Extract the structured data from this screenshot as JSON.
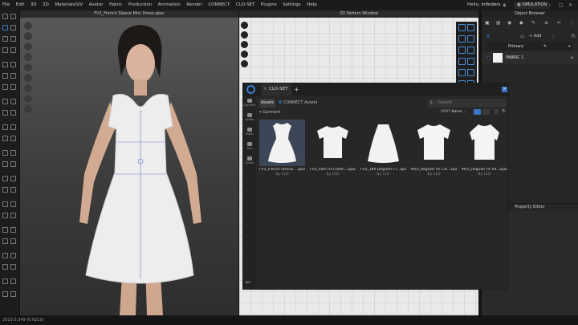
{
  "menubar": {
    "items": [
      "File",
      "Edit",
      "3D",
      "2D",
      "Materials/UV",
      "Avatar",
      "Fabric",
      "Production",
      "Animation",
      "Render",
      "CONNECT",
      "CLO-SET",
      "Plugins",
      "Settings",
      "Help"
    ],
    "greeting": "Hello,",
    "user": "infinders",
    "simulation": "SIMULATION"
  },
  "viewport3d": {
    "title": "FV2_French Sleeve Mini Dress.zpac"
  },
  "pattern_window": {
    "title": "2D Pattern Window"
  },
  "object_browser": {
    "title": "Object Browser",
    "add_label": "Add",
    "primary_label": "Primary",
    "fabric_name": "FABRIC 1"
  },
  "property_editor": {
    "title": "Property Editor"
  },
  "statusbar": {
    "text": "2023.0.349 (0.6210)"
  },
  "clo_panel": {
    "tab_title": "CLO-SET",
    "close": "×",
    "plus": "+",
    "sidebar": [
      "Garment",
      "Avatar",
      "Fabric",
      "Trim",
      "Scene"
    ],
    "tabs": {
      "assets": "Assets",
      "connect": "CONNECT Assets"
    },
    "search_placeholder": "Search",
    "breadcrumb": "Garment",
    "sort": {
      "label": "SORT",
      "value": "Name"
    },
    "items": [
      {
        "name": "FV2_French Sleeve ...zpac",
        "by": "By CLO"
      },
      {
        "name": "FV2_Slim Fit Crewn...zpac",
        "by": "By CLO"
      },
      {
        "name": "FV2_180 Degrees Fl...zpac",
        "by": "By CLO"
      },
      {
        "name": "MV2_Regular Fit Cre...zpac",
        "by": "By CLO"
      },
      {
        "name": "MV2_Regular Fit Ra...zpac",
        "by": "By CLO"
      }
    ],
    "back": "↩"
  },
  "colors": {
    "accent": "#3a76c9",
    "selected_card": "#3d4657"
  }
}
